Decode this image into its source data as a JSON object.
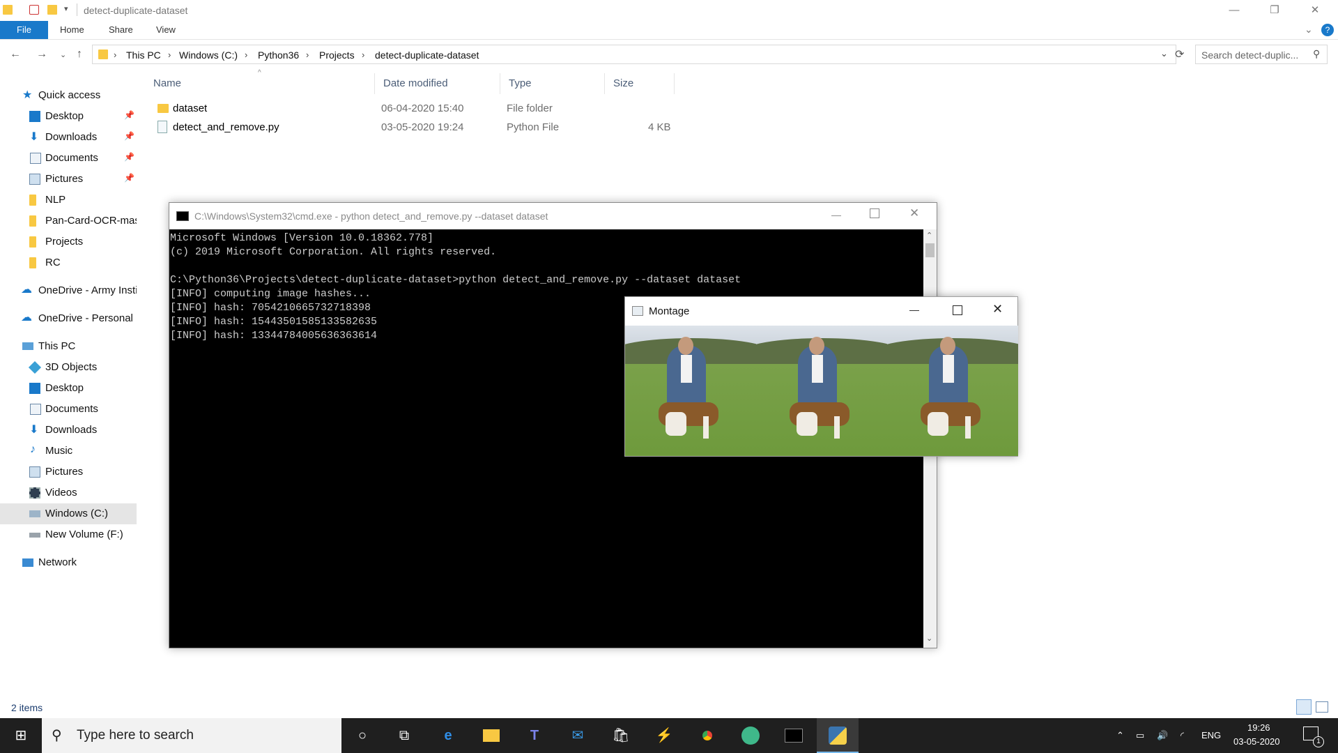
{
  "window": {
    "title": "detect-duplicate-dataset"
  },
  "ribbon": {
    "tabs": [
      "File",
      "Home",
      "Share",
      "View"
    ]
  },
  "address": {
    "crumbs": [
      "This PC",
      "Windows (C:)",
      "Python36",
      "Projects",
      "detect-duplicate-dataset"
    ],
    "search_placeholder": "Search detect-duplic..."
  },
  "nav": {
    "quick_access": "Quick access",
    "quick_items": [
      "Desktop",
      "Downloads",
      "Documents",
      "Pictures",
      "NLP",
      "Pan-Card-OCR-mast",
      "Projects",
      "RC"
    ],
    "onedrive_army": "OneDrive - Army Insti",
    "onedrive_personal": "OneDrive - Personal",
    "this_pc": "This PC",
    "pc_items": [
      "3D Objects",
      "Desktop",
      "Documents",
      "Downloads",
      "Music",
      "Pictures",
      "Videos",
      "Windows (C:)",
      "New Volume (F:)"
    ],
    "network": "Network"
  },
  "columns": {
    "name": "Name",
    "date": "Date modified",
    "type": "Type",
    "size": "Size"
  },
  "files": [
    {
      "name": "dataset",
      "date": "06-04-2020 15:40",
      "type": "File folder",
      "size": ""
    },
    {
      "name": "detect_and_remove.py",
      "date": "03-05-2020 19:24",
      "type": "Python File",
      "size": "4 KB"
    }
  ],
  "status": {
    "items": "2 items"
  },
  "cmd": {
    "title": "C:\\Windows\\System32\\cmd.exe - python  detect_and_remove.py --dataset dataset",
    "output": "Microsoft Windows [Version 10.0.18362.778]\n(c) 2019 Microsoft Corporation. All rights reserved.\n\nC:\\Python36\\Projects\\detect-duplicate-dataset>python detect_and_remove.py --dataset dataset\n[INFO] computing image hashes...\n[INFO] hash: 7054210665732718398\n[INFO] hash: 15443501585133582635\n[INFO] hash: 13344784005636363614"
  },
  "montage": {
    "title": "Montage"
  },
  "taskbar": {
    "search_placeholder": "Type here to search",
    "lang": "ENG",
    "time": "19:26",
    "date": "03-05-2020",
    "notification_count": "1"
  },
  "colors": {
    "accent": "#1979ca",
    "folder": "#f8c842",
    "taskbar": "#1f1f1f"
  }
}
